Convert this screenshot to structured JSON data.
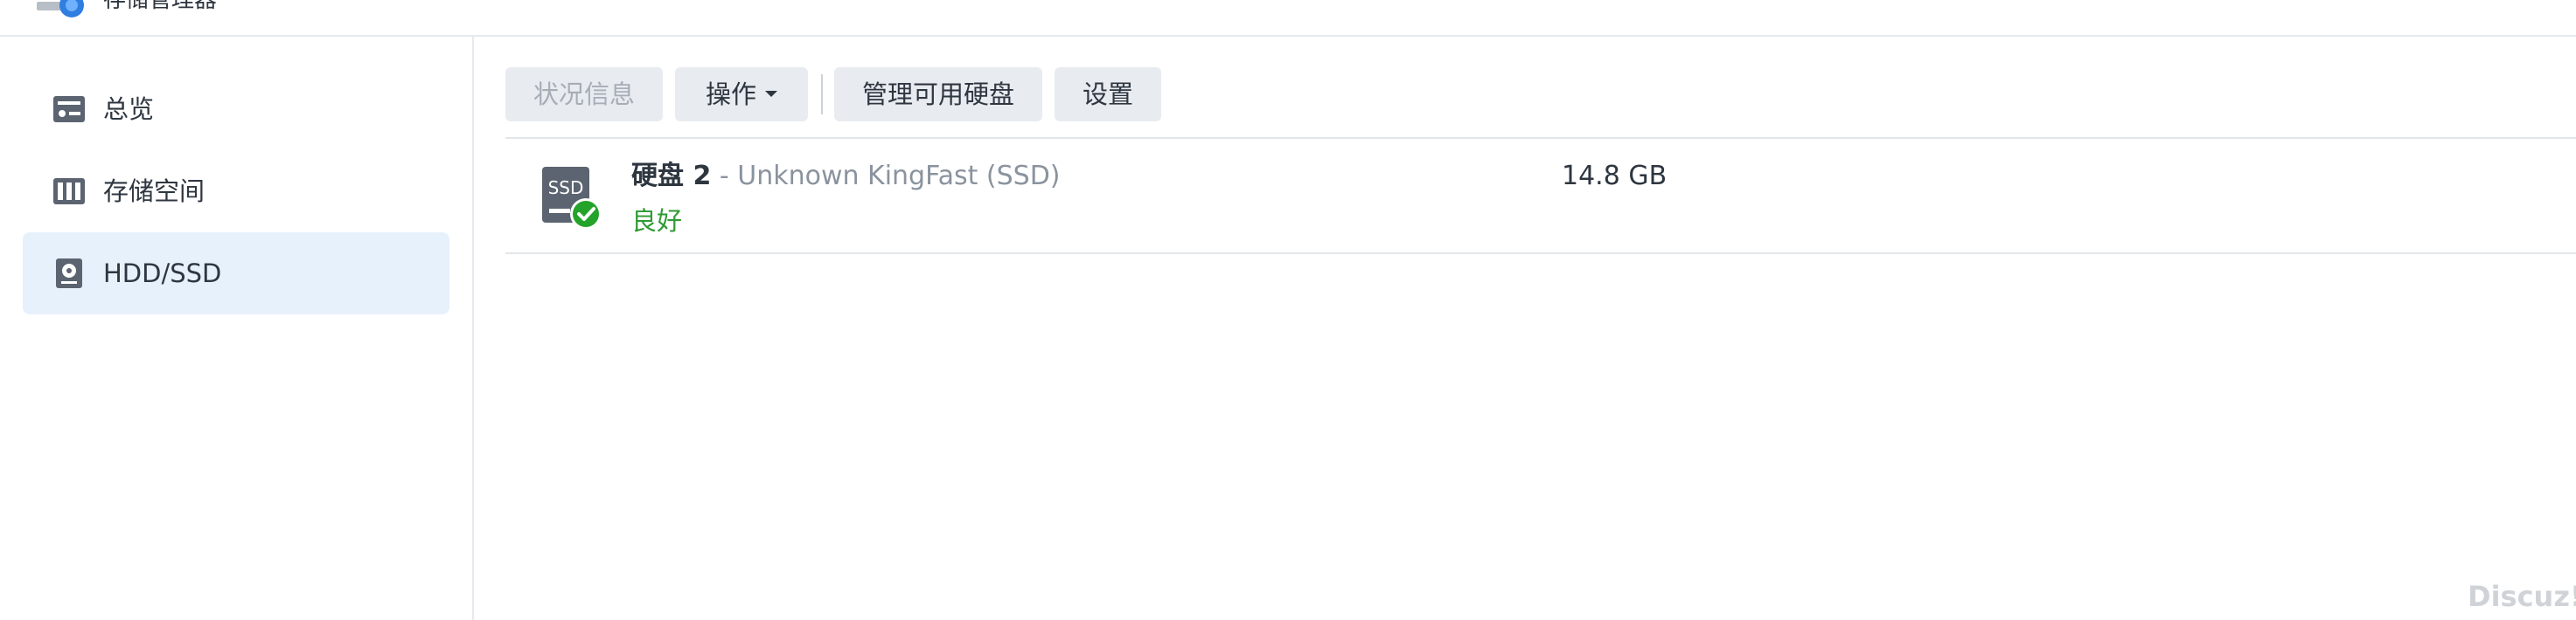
{
  "app": {
    "title": "存储管理器"
  },
  "sidebar": {
    "items": [
      {
        "label": "总览",
        "icon": "overview-icon",
        "active": false
      },
      {
        "label": "存储空间",
        "icon": "storage-pool-icon",
        "active": false
      },
      {
        "label": "HDD/SSD",
        "icon": "hdd-icon",
        "active": true
      }
    ]
  },
  "toolbar": {
    "status_info_label": "状况信息",
    "actions_label": "操作",
    "manage_disks_label": "管理可用硬盘",
    "settings_label": "设置"
  },
  "disks": [
    {
      "name": "硬盘 2",
      "separator": " - ",
      "model": "Unknown KingFast (SSD)",
      "status": "良好",
      "size": "14.8 GB",
      "icon_text": "SSD",
      "icon": "ssd-healthy-icon"
    }
  ],
  "watermark": "Discuz!",
  "colors": {
    "accent": "#e7f1fc",
    "healthy": "#2e9a33",
    "disk_icon": "#5b6470"
  }
}
